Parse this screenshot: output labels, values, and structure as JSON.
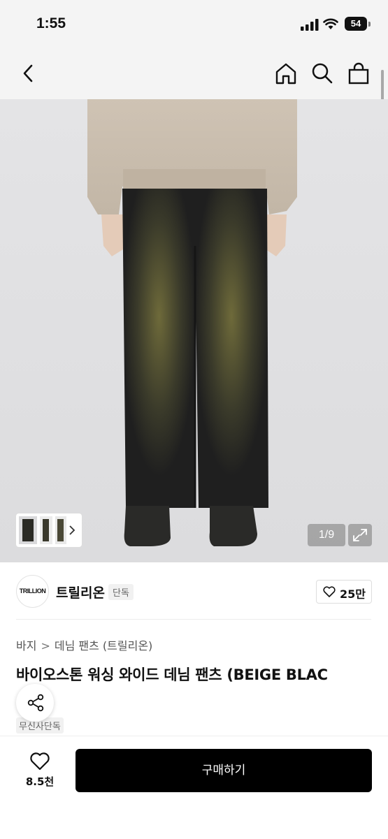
{
  "status_bar": {
    "time": "1:55",
    "battery": "54"
  },
  "nav": {
    "icons": [
      "back-icon",
      "home-icon",
      "search-icon",
      "shopping-bag-icon"
    ]
  },
  "gallery": {
    "counter": "1/9",
    "current_index": 1,
    "total": 9
  },
  "brand": {
    "logo_text": "TRILLION",
    "name": "트릴리온",
    "badge": "단독",
    "likes": "25만"
  },
  "breadcrumb": {
    "category": "바지",
    "subcategory": "데님 팬츠 (트릴리온)"
  },
  "product": {
    "title": "바이오스톤 워싱 와이드 데님 팬츠 (BEIGE BLAC",
    "store_badge": "무신사단독"
  },
  "bottom_bar": {
    "wish_count": "8.5천",
    "buy_label": "구매하기"
  },
  "colors": {
    "buy_button": "#000000",
    "header_bg": "#f4f4f4"
  }
}
